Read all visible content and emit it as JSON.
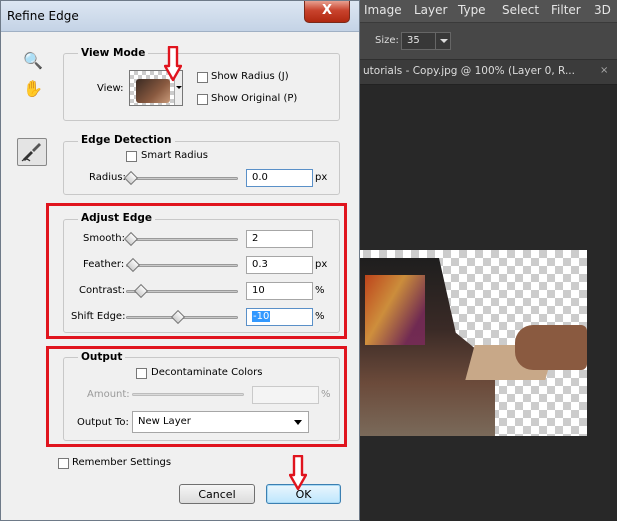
{
  "photoshop": {
    "menu": [
      "Image",
      "Layer",
      "Type",
      "Select",
      "Filter",
      "3D"
    ],
    "options": {
      "size_label": "Size:",
      "size_value": "35"
    },
    "document_tab": "utorials - Copy.jpg @ 100% (Layer 0, R...",
    "document_close": "×"
  },
  "dialog": {
    "title": "Refine Edge",
    "close_glyph": "X",
    "tools": {
      "zoom": "🔍",
      "hand": "✋"
    },
    "view_mode": {
      "title": "View Mode",
      "view_label": "View:",
      "show_radius": "Show Radius (J)",
      "show_original": "Show Original (P)"
    },
    "edge_detection": {
      "title": "Edge Detection",
      "smart_radius": "Smart Radius",
      "radius_label": "Radius:",
      "radius_value": "0.0",
      "radius_unit": "px",
      "radius_level": 0.0
    },
    "adjust_edge": {
      "title": "Adjust Edge",
      "smooth_label": "Smooth:",
      "smooth_value": "2",
      "feather_label": "Feather:",
      "feather_value": "0.3",
      "feather_unit": "px",
      "contrast_label": "Contrast:",
      "contrast_value": "10",
      "contrast_unit": "%",
      "shift_label": "Shift Edge:",
      "shift_value": "-10",
      "shift_unit": "%"
    },
    "output": {
      "title": "Output",
      "decontaminate": "Decontaminate Colors",
      "amount_label": "Amount:",
      "amount_unit": "%",
      "output_to_label": "Output To:",
      "output_to_value": "New Layer"
    },
    "remember": "Remember Settings",
    "cancel": "Cancel",
    "ok": "OK"
  },
  "colors": {
    "highlight": "#e0141e",
    "selection": "#3399ff"
  }
}
